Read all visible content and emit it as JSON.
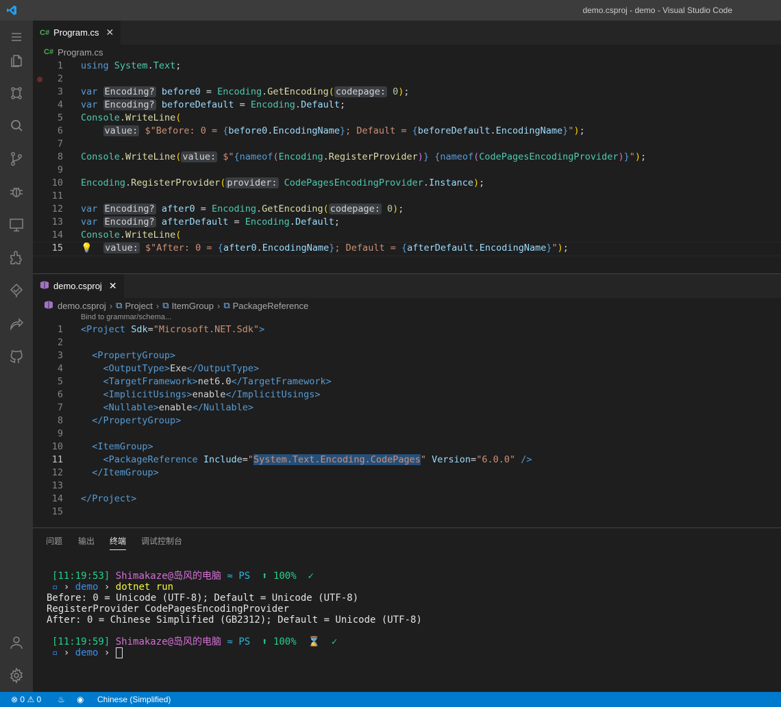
{
  "window": {
    "title": "demo.csproj - demo - Visual Studio Code"
  },
  "activity_icons": [
    "menu-icon",
    "explorer-icon",
    "source-control-graph-icon",
    "search-icon",
    "source-control-icon",
    "debug-icon",
    "remote-explorer-icon",
    "extensions-icon",
    "testing-icon",
    "live-share-icon",
    "github-icon",
    "account-icon",
    "settings-gear-icon"
  ],
  "editor1": {
    "tab_label": "Program.cs",
    "file_glyph": "C#",
    "breadcrumb": "Program.cs",
    "lines": [
      "1",
      "2",
      "3",
      "4",
      "5",
      "6",
      "7",
      "8",
      "9",
      "10",
      "11",
      "12",
      "13",
      "14",
      "15"
    ]
  },
  "editor2": {
    "tab_label": "demo.csproj",
    "breadcrumbs": [
      "demo.csproj",
      "Project",
      "ItemGroup",
      "PackageReference"
    ],
    "codelens": "Bind to grammar/schema...",
    "lines": [
      "1",
      "2",
      "3",
      "4",
      "5",
      "6",
      "7",
      "8",
      "9",
      "10",
      "11",
      "12",
      "13",
      "14",
      "15"
    ]
  },
  "panel": {
    "tabs": [
      "问题",
      "输出",
      "终端",
      "调试控制台"
    ],
    "active_tab": "终端",
    "terminal": {
      "prompt1_time": "[11:19:53]",
      "user": "Shimakaze@岛风的电脑",
      "shell": "PS",
      "battery": "100%",
      "check": "✓",
      "dir": "demo",
      "command": "dotnet run",
      "output": [
        "Before: 0 = Unicode (UTF-8); Default = Unicode (UTF-8)",
        "RegisterProvider CodePagesEncodingProvider",
        "After: 0 = Chinese Simplified (GB2312); Default = Unicode (UTF-8)"
      ],
      "prompt2_time": "[11:19:59]",
      "hourglass": "⌛"
    }
  },
  "status": {
    "errors": "0",
    "warnings": "0",
    "language": "Chinese (Simplified)"
  },
  "colors": {
    "statusbar": "#007acc",
    "activitybar": "#333333",
    "editor_bg": "#1e1e1e"
  }
}
